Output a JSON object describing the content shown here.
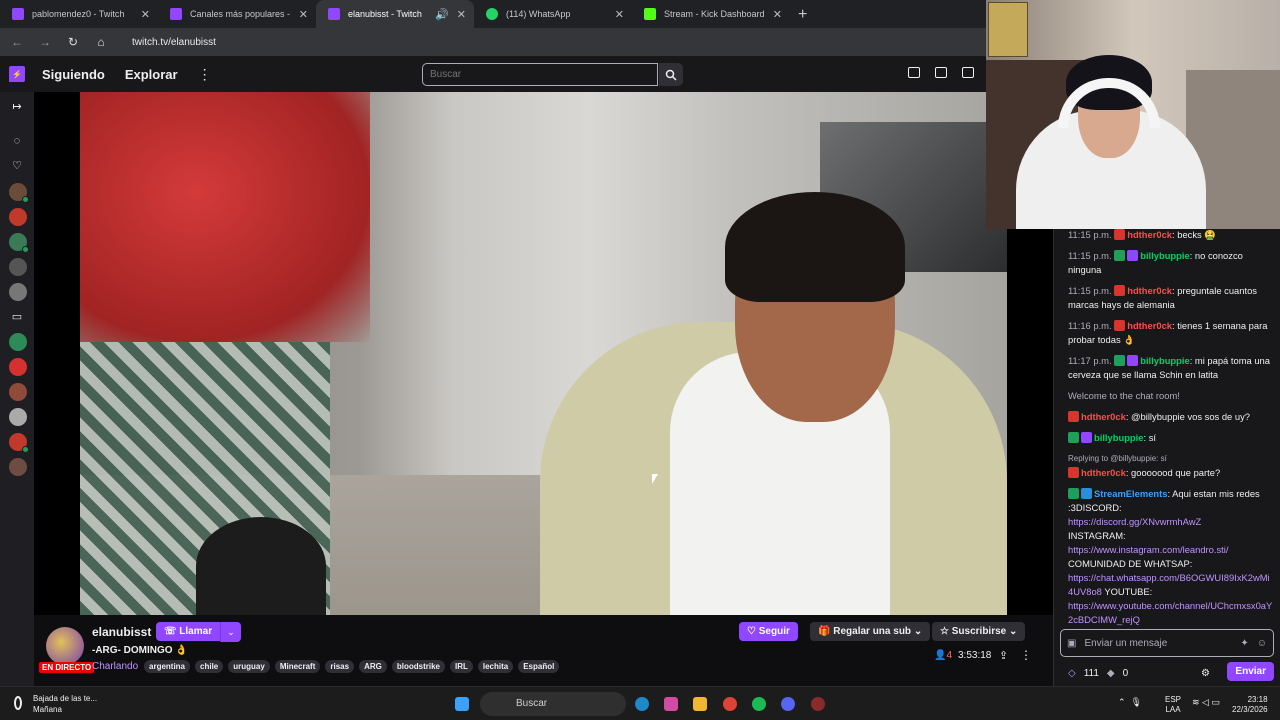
{
  "browser": {
    "tabs": [
      {
        "title": "pablomendez0 - Twitch",
        "color": "#9147ff"
      },
      {
        "title": "Canales más populares - Twitch",
        "color": "#9147ff"
      },
      {
        "title": "elanubisst - Twitch",
        "color": "#9147ff"
      },
      {
        "title": "(114) WhatsApp",
        "color": "#25d366"
      },
      {
        "title": "Stream - Kick Dashboard",
        "color": "#53fc18"
      }
    ],
    "url": "twitch.tv/elanubisst"
  },
  "topnav": {
    "following": "Siguiendo",
    "explore": "Explorar",
    "search_placeholder": "Buscar"
  },
  "channel": {
    "name": "elanubisst",
    "call_label": "Llamar",
    "stream_title": "-ARG- DOMINGO 👌",
    "live_badge": "EN DIRECTO",
    "category": "Charlando",
    "tags": [
      "argentina",
      "chile",
      "uruguay",
      "Minecraft",
      "risas",
      "ARG",
      "bloodstrike",
      "IRL",
      "lechita",
      "Español"
    ],
    "follow_label": "Seguir",
    "gift_label": "Regalar una sub",
    "subscribe_label": "Suscribirse",
    "viewers": "4",
    "uptime": "3:53:18"
  },
  "chat": {
    "messages": [
      {
        "time": "11:15 p.m.",
        "user": "hdther0ck",
        "text": ": becks 🤮",
        "user_color": "red"
      },
      {
        "time": "11:15 p.m.",
        "user": "billybuppie",
        "text": ": no conozco ninguna",
        "user_color": "green"
      },
      {
        "time": "11:15 p.m.",
        "user": "hdther0ck",
        "text": ": preguntale cuantos marcas hays de alemania",
        "user_color": "red"
      },
      {
        "time": "11:16 p.m.",
        "user": "hdther0ck",
        "text": ": tienes 1 semana para probar todas 👌",
        "user_color": "red"
      },
      {
        "time": "11:17 p.m.",
        "user": "billybuppie",
        "text": ": mi papá toma una cerveza que se llama Schin en latita",
        "user_color": "green"
      }
    ],
    "welcome": "Welcome to the chat room!",
    "msg_a_user": "hdther0ck",
    "msg_a_text": ": @billybuppie vos sos de uy?",
    "msg_b_user": "billybuppie",
    "msg_b_text": ": sí",
    "reply_to": "Replying to @billybuppie: sí",
    "msg_c_user": "hdther0ck",
    "msg_c_text": ": gooooood que parte?",
    "se_user": "StreamElements",
    "se_text": ": Aqui estan mis redes :3DISCORD:",
    "discord_link": "https://discord.gg/XNvwrmhAwZ",
    "instagram_label": "INSTAGRAM:",
    "instagram_link": "https://www.instagram.com/leandro.sti/",
    "whatsapp_label": "COMUNIDAD DE WHATSAP:",
    "whatsapp_link": "https://chat.whatsapp.com/B6OGWUI89IxK2wMi4UV8o8",
    "youtube_label": " YOUTUBE:",
    "youtube_link": "https://www.youtube.com/channel/UChcmxsx0aY2cBDCIMW_rejQ",
    "input_placeholder": "Enviar un mensaje",
    "points": "111",
    "bits": "0",
    "send_label": "Enviar"
  },
  "taskbar": {
    "weather_line1": "Bajada de las te...",
    "weather_line2": "Mañana",
    "search": "Buscar",
    "lang1": "ESP",
    "lang2": "LAA",
    "time": "23:18",
    "date": "22/3/2026"
  }
}
